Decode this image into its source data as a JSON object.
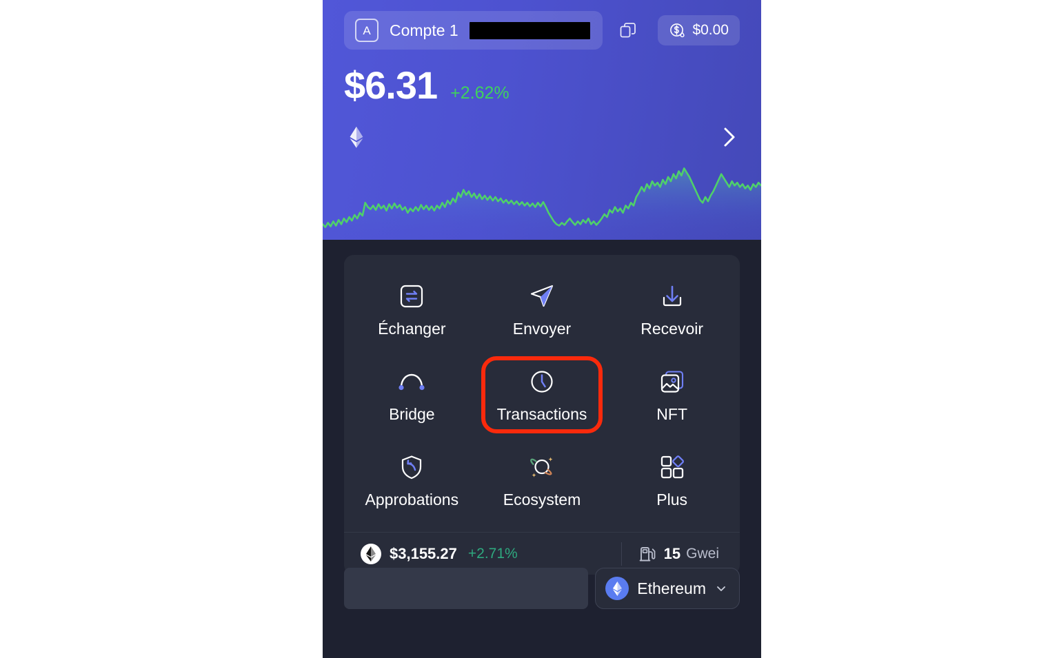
{
  "header": {
    "account": {
      "avatar_letter": "A",
      "name": "Compte 1",
      "address_redacted": true,
      "copy_icon": "copy-icon"
    },
    "earn_badge": {
      "icon": "dollar-drop-icon",
      "value": "$0.00"
    },
    "balance": {
      "amount": "$6.31",
      "change": "+2.62%"
    },
    "token_icon": "ethereum-diamond-icon",
    "next_icon": "chevron-right-icon"
  },
  "actions": [
    {
      "label": "Échanger",
      "icon": "swap-icon",
      "highlighted": false
    },
    {
      "label": "Envoyer",
      "icon": "send-paper-plane-icon",
      "highlighted": false
    },
    {
      "label": "Recevoir",
      "icon": "receive-download-icon",
      "highlighted": false
    },
    {
      "label": "Bridge",
      "icon": "bridge-arc-icon",
      "highlighted": false
    },
    {
      "label": "Transactions",
      "icon": "clock-icon",
      "highlighted": true
    },
    {
      "label": "NFT",
      "icon": "image-stack-icon",
      "highlighted": false
    },
    {
      "label": "Approbations",
      "icon": "shield-arrow-icon",
      "highlighted": false
    },
    {
      "label": "Ecosystem",
      "icon": "planet-sparkle-icon",
      "highlighted": false
    },
    {
      "label": "Plus",
      "icon": "grid-more-icon",
      "highlighted": false
    }
  ],
  "stats": {
    "token_icon": "ethereum-coin-icon",
    "price": "$3,155.27",
    "price_change": "+2.71%",
    "gas_icon": "fuel-pump-icon",
    "gas_value": "15",
    "gas_unit": "Gwei"
  },
  "bottom": {
    "network": {
      "icon": "ethereum-network-icon",
      "name": "Ethereum",
      "chevron": "chevron-down-icon"
    }
  },
  "colors": {
    "header_gradient_start": "#5157d8",
    "header_gradient_end": "#4449b8",
    "page_background": "#1e2130",
    "card_background": "#282c3a",
    "accent_blue": "#6f7ff5",
    "positive_green": "#3fd15e",
    "stats_green": "#2ea97f",
    "highlight_red": "#fa2a0c",
    "sparkline_green": "#4fd06a"
  },
  "chart_data": {
    "type": "line",
    "title": "",
    "xlabel": "",
    "ylabel": "",
    "legend": [],
    "grid": false,
    "series": [
      {
        "name": "ETH price",
        "values": [
          14,
          10,
          16,
          11,
          18,
          12,
          20,
          14,
          22,
          17,
          24,
          19,
          27,
          22,
          30,
          26,
          44,
          38,
          35,
          40,
          34,
          42,
          36,
          40,
          33,
          42,
          36,
          43,
          37,
          41,
          34,
          38,
          30,
          36,
          32,
          38,
          33,
          41,
          35,
          40,
          34,
          39,
          33,
          40,
          36,
          44,
          38,
          47,
          42,
          50,
          45,
          58,
          52,
          62,
          55,
          60,
          52,
          57,
          50,
          56,
          49,
          54,
          48,
          53,
          47,
          52,
          46,
          50,
          44,
          48,
          43,
          47,
          42,
          46,
          41,
          45,
          40,
          44,
          39,
          43,
          38,
          44,
          39,
          45,
          38,
          30,
          24,
          18,
          14,
          12,
          16,
          13,
          18,
          22,
          17,
          13,
          18,
          14,
          20,
          16,
          22,
          14,
          18,
          13,
          17,
          22,
          28,
          24,
          34,
          30,
          38,
          32,
          36,
          30,
          40,
          36,
          44,
          40,
          52,
          58,
          66,
          60,
          70,
          64,
          74,
          68,
          72,
          66,
          76,
          70,
          80,
          74,
          84,
          78,
          88,
          82,
          92,
          86,
          80,
          72,
          64,
          56,
          48,
          44,
          52,
          46,
          54,
          60,
          68,
          76,
          84,
          78,
          72,
          66,
          74,
          68,
          72,
          66,
          70,
          64,
          68,
          62,
          70,
          66,
          72,
          68
        ]
      }
    ],
    "ylim": [
      0,
      100
    ]
  }
}
